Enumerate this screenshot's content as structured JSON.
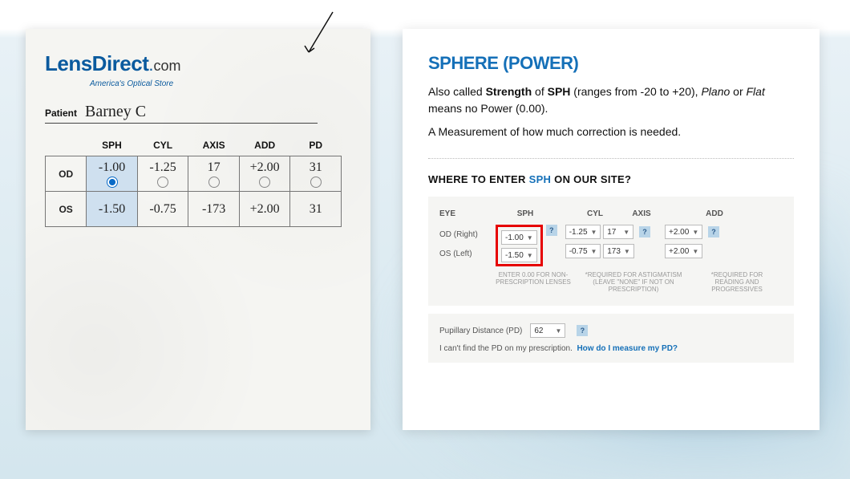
{
  "logo": {
    "main": "LensDirect",
    "dot": ".",
    "com": "com",
    "tagline": "America's Optical Store"
  },
  "patient": {
    "label": "Patient",
    "name": "Barney C"
  },
  "rx_headers": [
    "",
    "SPH",
    "CYL",
    "AXIS",
    "ADD",
    "PD"
  ],
  "rx_rows": [
    {
      "eye": "OD",
      "sph": "-1.00",
      "cyl": "-1.25",
      "axis": "17",
      "add": "+2.00",
      "pd": "31",
      "selected": "sph"
    },
    {
      "eye": "OS",
      "sph": "-1.50",
      "cyl": "-0.75",
      "axis": "-173",
      "add": "+2.00",
      "pd": "31"
    }
  ],
  "card": {
    "title": "SPHERE (POWER)",
    "p1_a": "Also called ",
    "p1_b": "Strength",
    "p1_c": " of ",
    "p1_d": "SPH",
    "p1_e": " (ranges from -20 to +20), ",
    "p2_a": "Plano",
    "p2_b": " or ",
    "p2_c": "Flat",
    "p2_d": " means no Power (0.00).",
    "p3": "A Measurement of how much correction is needed.",
    "where_a": "WHERE TO ENTER ",
    "where_b": "SPH",
    "where_c": " ON OUR SITE?"
  },
  "form": {
    "headers": {
      "eye": "EYE",
      "sph": "SPH",
      "cyl": "CYL",
      "axis": "AXIS",
      "add": "ADD"
    },
    "rows": [
      {
        "eye": "OD (Right)",
        "sph": "-1.00",
        "cyl": "-1.25",
        "axis": "17",
        "add": "+2.00"
      },
      {
        "eye": "OS (Left)",
        "sph": "-1.50",
        "cyl": "-0.75",
        "axis": "173",
        "add": "+2.00"
      }
    ],
    "footnotes": {
      "sph": "ENTER 0.00 FOR NON-PRESCRIPTION LENSES",
      "cyl": "*REQUIRED FOR ASTIGMATISM (LEAVE \"NONE\" IF NOT ON PRESCRIPTION)",
      "add": "*REQUIRED FOR READING AND PROGRESSIVES"
    },
    "pd": {
      "label": "Pupillary Distance (PD)",
      "value": "62",
      "cant_find": "I can't find the PD on my prescription.",
      "link": "How do I measure my PD?"
    }
  }
}
